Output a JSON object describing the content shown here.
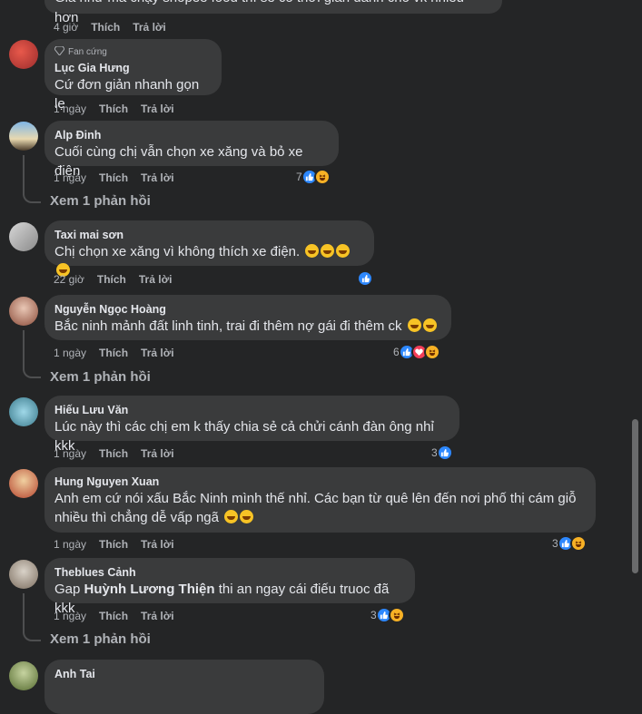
{
  "top_comment": {
    "text": "Gia như mà chạy shopee food thì sẽ có thời gian dành cho vk nhiều hơn",
    "time": "4 giờ",
    "like": "Thích",
    "reply": "Trả lời"
  },
  "comments": [
    {
      "badge": "Fan cứng",
      "name": "Lục Gia Hưng",
      "text": "Cứ đơn giản nhanh gọn lẹ",
      "time": "1 ngày",
      "like": "Thích",
      "reply": "Trả lời"
    },
    {
      "name": "Alp Đinh",
      "text": "Cuối cùng chị vẫn chọn xe xăng và bỏ xe điện",
      "time": "1 ngày",
      "like": "Thích",
      "reply": "Trả lời",
      "reactions": {
        "count": "7"
      },
      "replies_link": "Xem 1 phản hồi"
    },
    {
      "name": "Taxi mai sơn",
      "text": "Chị chọn xe xăng vì không thích xe điện.",
      "time": "22 giờ",
      "like": "Thích",
      "reply": "Trả lời"
    },
    {
      "name": "Nguyễn Ngọc Hoàng",
      "text": "Bắc ninh mảnh đất linh tinh, trai đi thêm nợ gái đi thêm ck",
      "time": "1 ngày",
      "like": "Thích",
      "reply": "Trả lời",
      "reactions": {
        "count": "6"
      },
      "replies_link": "Xem 1 phản hồi"
    },
    {
      "name": "Hiếu Lưu Văn",
      "text": "Lúc này thì các chị em k thấy chia sẻ cả chửi cánh đàn ông nhỉ kkk",
      "time": "1 ngày",
      "like": "Thích",
      "reply": "Trả lời",
      "reactions": {
        "count": "3"
      }
    },
    {
      "name": "Hung Nguyen Xuan",
      "text_line1": "Anh em cứ nói xấu Bắc Ninh mình thế nhỉ. Các bạn từ quê lên đến nơi phố thị cám giỗ",
      "text_line2": "nhiều thì chẳng dễ vấp ngã",
      "time": "1 ngày",
      "like": "Thích",
      "reply": "Trả lời",
      "reactions": {
        "count": "3"
      }
    },
    {
      "name": "Theblues Cảnh",
      "text_prefix": "Gap",
      "mention": "Huỳnh Lương Thiện",
      "text_suffix": "thi an ngay cái điếu truoc đã kkk",
      "time": "1 ngày",
      "like": "Thích",
      "reply": "Trả lời",
      "reactions": {
        "count": "3"
      },
      "replies_link": "Xem 1 phản hồi"
    },
    {
      "name": "Anh Tai"
    }
  ],
  "colors": {
    "background": "#242526",
    "bubble": "#3a3b3c",
    "like": "#2d88ff",
    "love": "#f33e58",
    "haha": "#f7b125"
  },
  "icons": [
    "like-icon",
    "love-icon",
    "haha-icon",
    "diamond-icon"
  ]
}
